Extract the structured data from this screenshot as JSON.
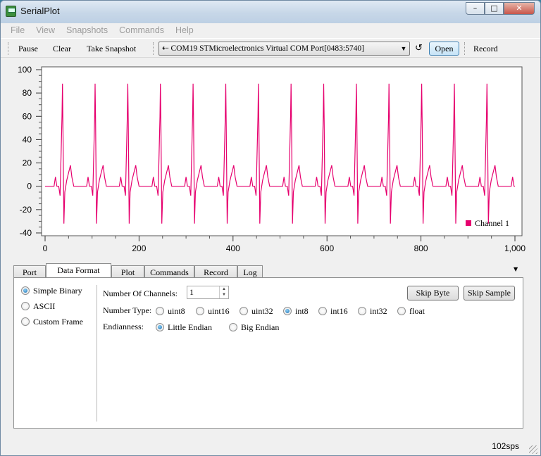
{
  "window": {
    "title": "SerialPlot",
    "min": "–",
    "max": "□",
    "close": "✕"
  },
  "menu": [
    "File",
    "View",
    "Snapshots",
    "Commands",
    "Help"
  ],
  "toolbar": {
    "pause": "Pause",
    "clear": "Clear",
    "snapshot": "Take Snapshot",
    "port": "COM19 STMicroelectronics Virtual COM Port[0483:5740]",
    "open": "Open",
    "record": "Record"
  },
  "chart_data": {
    "type": "line",
    "xlim": [
      0,
      1000
    ],
    "ylim": [
      -40,
      100
    ],
    "x_ticks": [
      "0",
      "200",
      "400",
      "600",
      "800",
      "1,000"
    ],
    "y_ticks": [
      "100",
      "80",
      "60",
      "40",
      "20",
      "0",
      "-20",
      "-40"
    ],
    "legend": {
      "position": "bottom-right"
    },
    "series": [
      {
        "name": "Channel 1",
        "color": "#e6006e",
        "beat_period": 69.5,
        "first_peak_x": 37,
        "beat_template": [
          [
            -24,
            0
          ],
          [
            -18,
            0
          ],
          [
            -15,
            8
          ],
          [
            -12,
            0
          ],
          [
            -8,
            0
          ],
          [
            -5,
            -8
          ],
          [
            -1,
            60
          ],
          [
            0,
            88
          ],
          [
            1,
            55
          ],
          [
            3,
            -32
          ],
          [
            5,
            -5
          ],
          [
            9,
            5
          ],
          [
            12,
            10
          ],
          [
            17,
            18
          ],
          [
            20,
            8
          ],
          [
            24,
            0
          ],
          [
            30,
            0
          ]
        ],
        "x_range": [
          0,
          1000
        ]
      }
    ]
  },
  "tabs": [
    "Port",
    "Data Format",
    "Plot",
    "Commands",
    "Record",
    "Log"
  ],
  "active_tab": "Data Format",
  "frame_formats": [
    "Simple Binary",
    "ASCII",
    "Custom Frame"
  ],
  "selected_format": "Simple Binary",
  "channels": {
    "label": "Number Of Channels:",
    "value": "1"
  },
  "number_type": {
    "label": "Number Type:",
    "options": [
      "uint8",
      "uint16",
      "uint32",
      "int8",
      "int16",
      "int32",
      "float"
    ],
    "selected": "int8"
  },
  "endianness": {
    "label": "Endianness:",
    "options": [
      "Little Endian",
      "Big Endian"
    ],
    "selected": "Little Endian"
  },
  "buttons": {
    "skip_byte": "Skip Byte",
    "skip_sample": "Skip Sample"
  },
  "status": {
    "sps": "102sps"
  }
}
